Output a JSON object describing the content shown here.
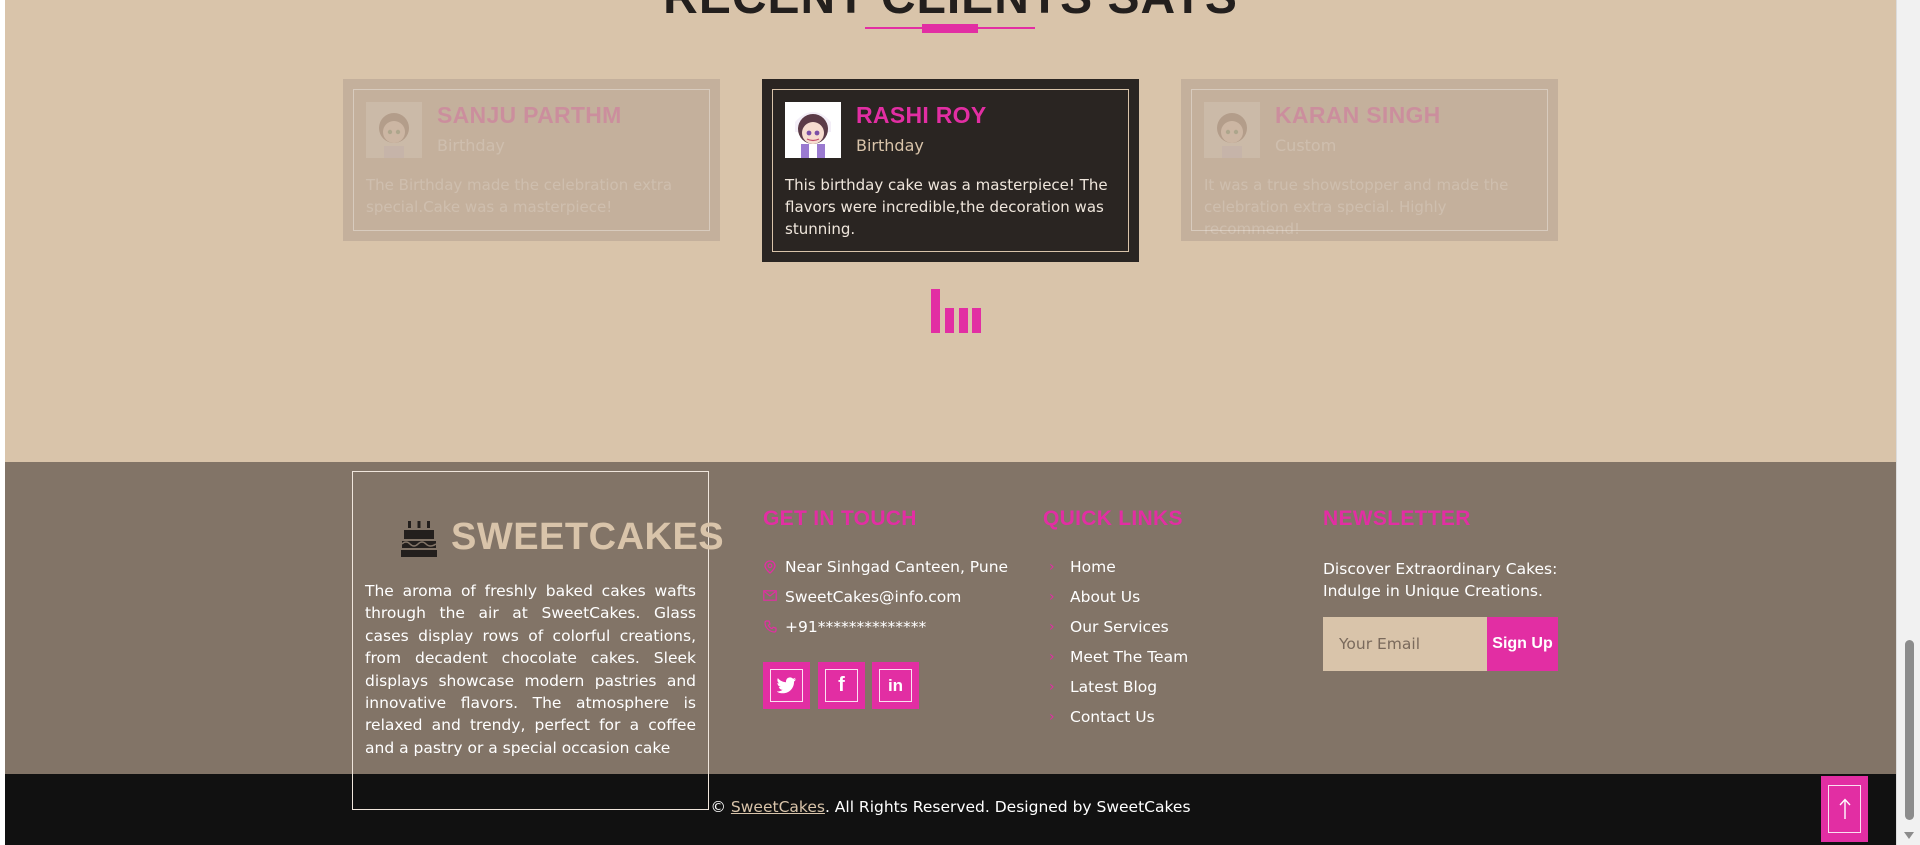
{
  "section": {
    "title": "RECENT CLIENTS SAYS"
  },
  "testimonials": [
    {
      "name": "SANJU PARTHM",
      "occasion": "Birthday",
      "text": "The Birthday made the celebration extra special.Cake was a masterpiece!"
    },
    {
      "name": "RASHI ROY",
      "occasion": "Birthday",
      "text": "This birthday cake was a masterpiece! The flavors were incredible,the decoration was stunning."
    },
    {
      "name": "KARAN SINGH",
      "occasion": "Custom",
      "text": "It was a true showstopper and made the celebration extra special. Highly recommend!"
    }
  ],
  "footer": {
    "brand": "SWEETCAKES",
    "about": "The aroma of freshly baked cakes wafts through the air at SweetCakes. Glass cases display rows of colorful creations, from decadent chocolate cakes. Sleek displays showcase modern pastries and innovative flavors. The atmosphere is relaxed and trendy, perfect for a coffee and a pastry or a special occasion cake",
    "contact": {
      "title": "GET IN TOUCH",
      "address": "Near Sinhgad Canteen, Pune",
      "email": "SweetCakes@info.com",
      "phone": "+91**************"
    },
    "social_letters": {
      "twitter": "t",
      "facebook": "f",
      "linkedin": "in"
    },
    "quick_links": {
      "title": "QUICK LINKS",
      "items": [
        "Home",
        "About Us",
        "Our Services",
        "Meet The Team",
        "Latest Blog",
        "Contact Us"
      ]
    },
    "newsletter": {
      "title": "NEWSLETTER",
      "text": "Discover Extraordinary Cakes: Indulge in Unique Creations.",
      "placeholder": "Your Email",
      "button": "Sign Up"
    },
    "copyright": {
      "prefix": "© ",
      "link": "SweetCakes",
      "suffix": ". All Rights Reserved. Designed by SweetCakes"
    }
  },
  "colors": {
    "accent": "#e22ea3",
    "beige": "#d9c4aa",
    "footer_bg": "#827467",
    "dark": "#2a2522"
  },
  "icons": [
    "cake-icon",
    "map-pin-icon",
    "mail-icon",
    "phone-icon",
    "twitter-icon",
    "facebook-icon",
    "linkedin-icon",
    "chevron-right-icon",
    "arrow-up-icon"
  ]
}
